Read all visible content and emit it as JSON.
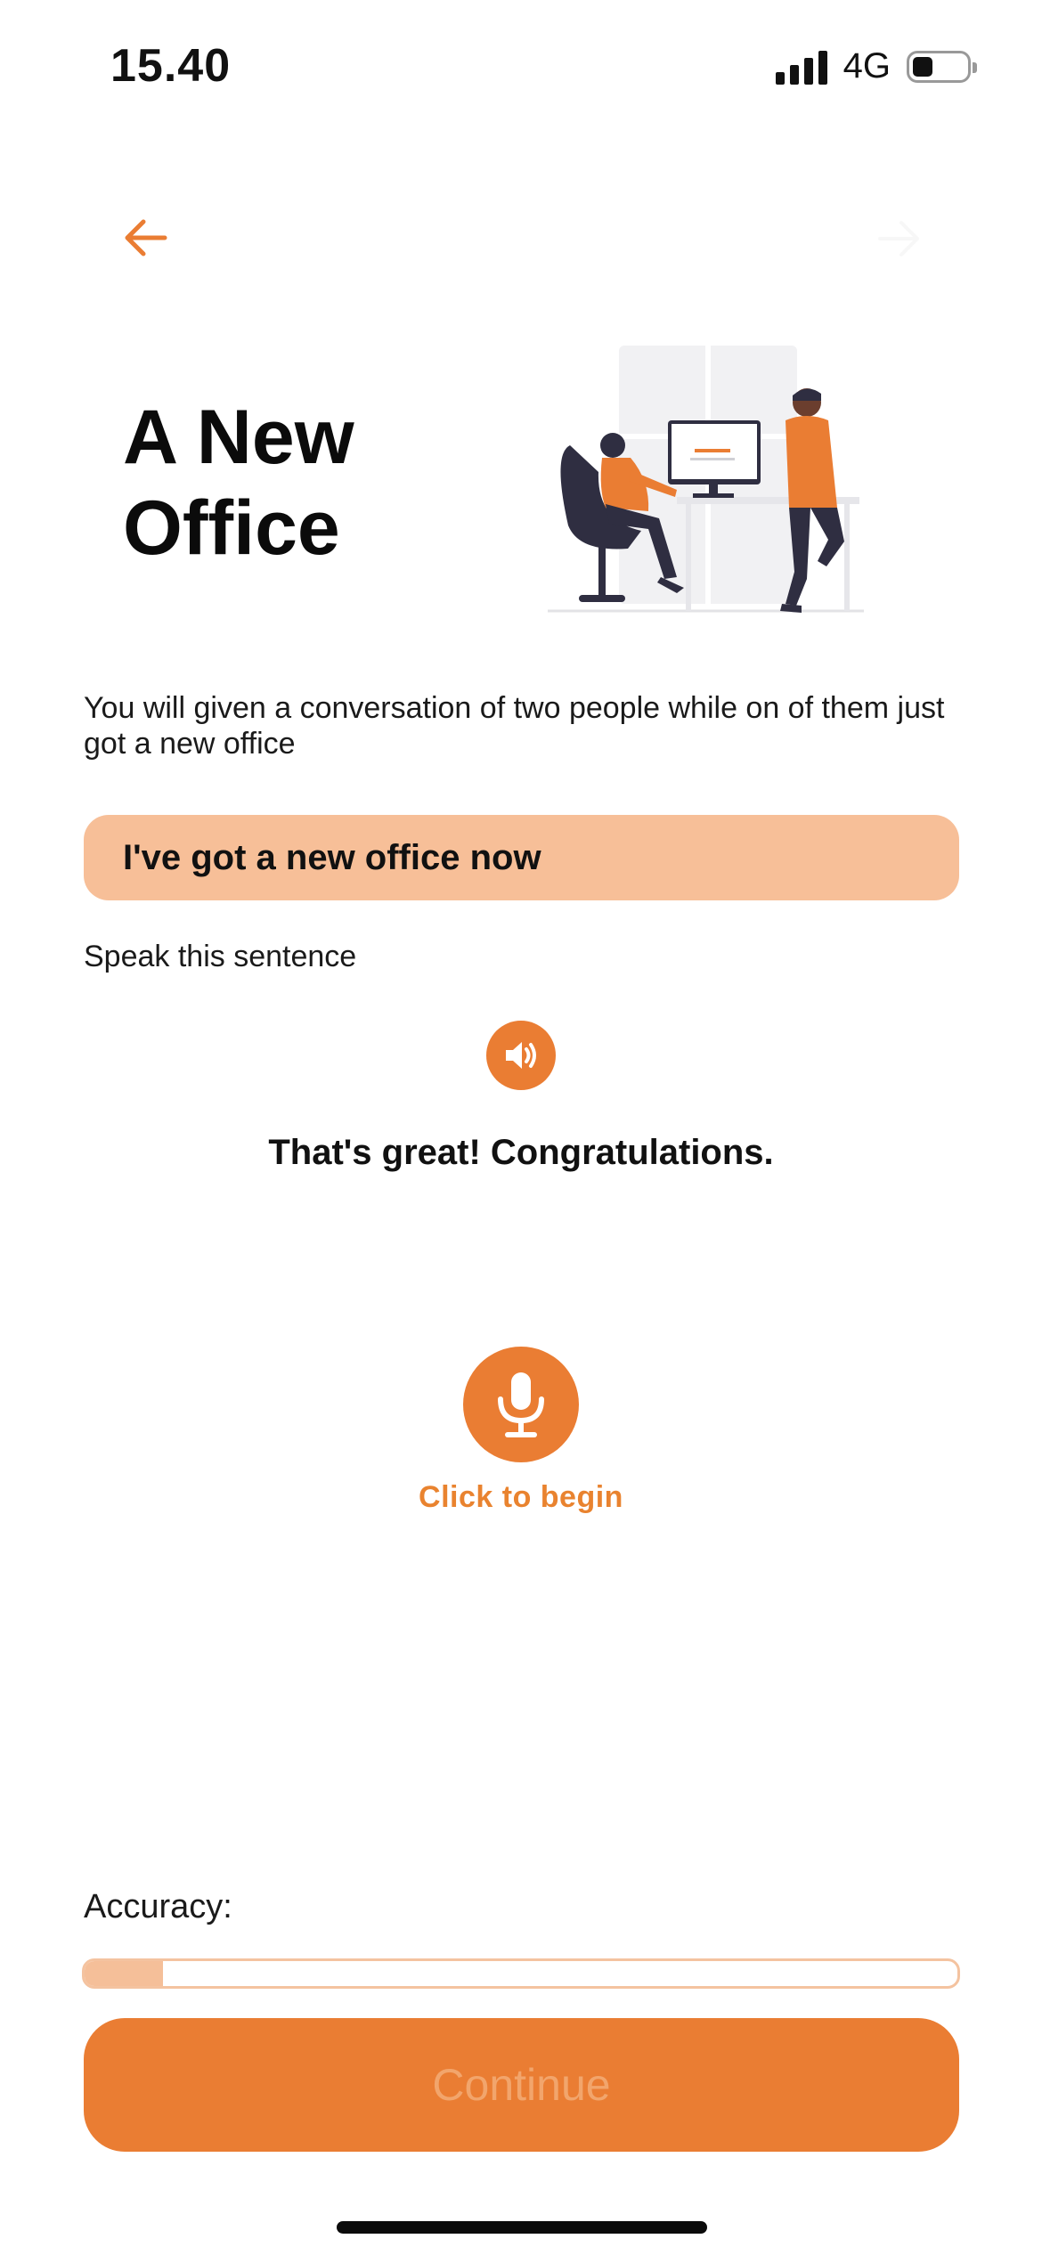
{
  "status_bar": {
    "time": "15.40",
    "network": "4G"
  },
  "header": {
    "back_icon": "arrow-left-icon"
  },
  "lesson": {
    "title_line1": "A New",
    "title_line2": "Office",
    "description": "You will given a conversation of two people while on of them just got a new office",
    "sentence": "I've got a new office now",
    "speak_label": "Speak this sentence",
    "speaker_icon": "speaker-icon",
    "response": "That's great! Congratulations."
  },
  "recorder": {
    "mic_icon": "microphone-icon",
    "label": "Click to begin"
  },
  "accuracy": {
    "label": "Accuracy:",
    "progress_fraction": 0.09
  },
  "footer": {
    "continue_label": "Continue"
  },
  "colors": {
    "accent": "#ea7d33",
    "accent_light": "#f7bf98",
    "accent_text": "#e9832f"
  }
}
